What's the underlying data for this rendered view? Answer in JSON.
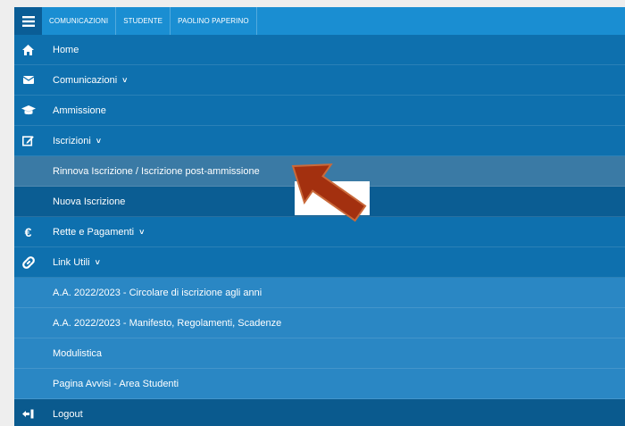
{
  "topbar": {
    "crumbs": [
      "COMUNICAZIONI",
      "STUDENTE",
      "PAOLINO PAPERINO"
    ]
  },
  "menu": {
    "items": [
      {
        "label": "Home",
        "icon": "home-icon"
      },
      {
        "label": "Comunicazioni",
        "icon": "envelope-icon",
        "expandable": true
      },
      {
        "label": "Ammissione",
        "icon": "graduation-cap-icon"
      },
      {
        "label": "Iscrizioni",
        "icon": "edit-icon",
        "expandable": true
      },
      {
        "label": "Rinnova Iscrizione / Iscrizione post-ammissione",
        "sub": true,
        "active": true
      },
      {
        "label": "Nuova Iscrizione",
        "sub": true
      },
      {
        "label": "Rette e Pagamenti",
        "icon": "euro-icon",
        "expandable": true
      },
      {
        "label": "Link Utili",
        "icon": "link-icon",
        "expandable": true
      },
      {
        "label": "A.A. 2022/2023 - Circolare di iscrizione agli anni",
        "sub": true
      },
      {
        "label": "A.A. 2022/2023 - Manifesto, Regolamenti, Scadenze",
        "sub": true
      },
      {
        "label": "Modulistica",
        "sub": true
      },
      {
        "label": "Pagina Avvisi - Area Studenti",
        "sub": true
      },
      {
        "label": "Logout",
        "icon": "logout-icon"
      }
    ]
  },
  "colors": {
    "topbar": "#1a8ed2",
    "menu": "#0e70ae",
    "submenu": "#2a87c4",
    "active": "#3a7aa5",
    "arrow": "#a3300f"
  }
}
